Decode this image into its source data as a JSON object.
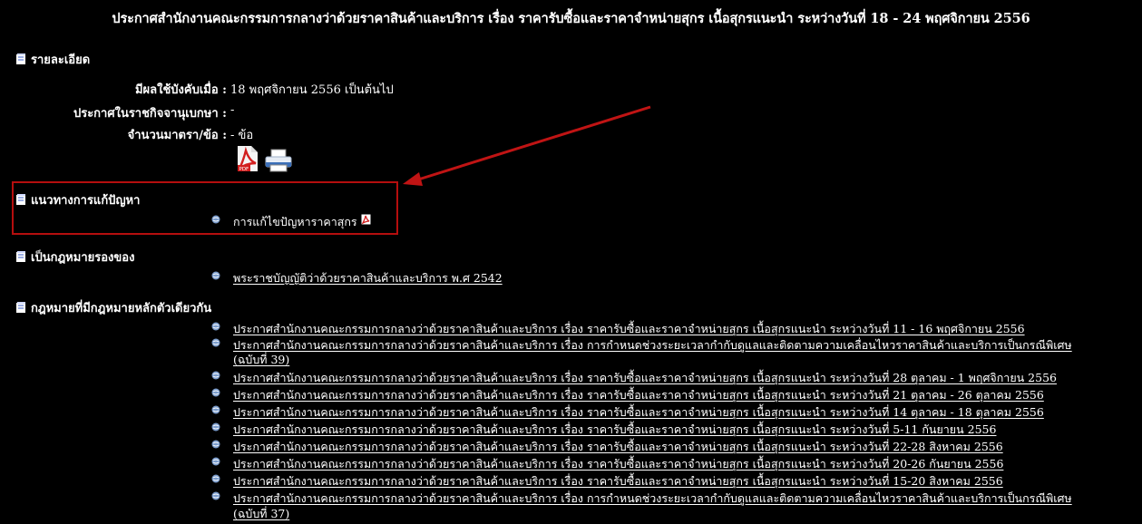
{
  "page_title": "ประกาศสำนักงานคณะกรรมการกลางว่าด้วยราคาสินค้าและบริการ เรื่อง ราคารับซื้อและราคาจำหน่ายสุกร เนื้อสุกรแนะนำ ระหว่างวันที่ 18 - 24 พฤศจิกายน 2556",
  "details": {
    "heading": "รายละเอียด",
    "effective_label": "มีผลใช้บังคับเมื่อ :",
    "effective_value": "18 พฤศจิกายน 2556 เป็นต้นไป",
    "gazette_label": "ประกาศในราชกิจจานุเบกษา :",
    "gazette_value": "-",
    "sections_label": "จำนวนมาตรา/ข้อ :",
    "sections_value": "- ข้อ"
  },
  "solution": {
    "heading": "แนวทางการแก้ปัญหา",
    "item": "การแก้ไขปัญหาราคาสุกร"
  },
  "subordinate": {
    "heading": "เป็นกฎหมายรองของ",
    "item": "พระราชบัญญัติว่าด้วยราคาสินค้าและบริการ พ.ศ 2542"
  },
  "related": {
    "heading": "กฎหมายที่มีกฎหมายหลักตัวเดียวกัน",
    "items": [
      "ประกาศสำนักงานคณะกรรมการกลางว่าด้วยราคาสินค้าและบริการ เรื่อง ราคารับซื้อและราคาจำหน่ายสุกร เนื้อสุกรแนะนำ ระหว่างวันที่ 11 - 16 พฤศจิกายน 2556",
      "ประกาศสำนักงานคณะกรรมการกลางว่าด้วยราคาสินค้าและบริการ เรื่อง การกำหนดช่วงระยะเวลากำกับดูแลและติดตามความเคลื่อนไหวราคาสินค้าและบริการเป็นกรณีพิเศษ",
      "(ฉบับที่ 39)",
      "ประกาศสำนักงานคณะกรรมการกลางว่าด้วยราคาสินค้าและบริการ เรื่อง ราคารับซื้อและราคาจำหน่ายสุกร เนื้อสุกรแนะนำ ระหว่างวันที่ 28 ตุลาคม - 1 พฤศจิกายน 2556",
      "ประกาศสำนักงานคณะกรรมการกลางว่าด้วยราคาสินค้าและบริการ เรื่อง ราคารับซื้อและราคาจำหน่ายสุกร เนื้อสุกรแนะนำ ระหว่างวันที่ 21 ตุลาคม - 26 ตุลาคม 2556",
      "ประกาศสำนักงานคณะกรรมการกลางว่าด้วยราคาสินค้าและบริการ เรื่อง ราคารับซื้อและราคาจำหน่ายสุกร เนื้อสุกรแนะนำ ระหว่างวันที่ 14 ตุลาคม - 18 ตุลาคม 2556",
      "ประกาศสำนักงานคณะกรรมการกลางว่าด้วยราคาสินค้าและบริการ เรื่อง ราคารับซื้อและราคาจำหน่ายสุกร เนื้อสุกรแนะนำ ระหว่างวันที่ 5-11 กันยายน 2556",
      "ประกาศสำนักงานคณะกรรมการกลางว่าด้วยราคาสินค้าและบริการ เรื่อง ราคารับซื้อและราคาจำหน่ายสุกร เนื้อสุกรแนะนำ ระหว่างวันที่ 22-28 สิงหาคม 2556",
      "ประกาศสำนักงานคณะกรรมการกลางว่าด้วยราคาสินค้าและบริการ เรื่อง ราคารับซื้อและราคาจำหน่ายสุกร เนื้อสุกรแนะนำ ระหว่างวันที่ 20-26 กันยายน 2556",
      "ประกาศสำนักงานคณะกรรมการกลางว่าด้วยราคาสินค้าและบริการ เรื่อง ราคารับซื้อและราคาจำหน่ายสุกร เนื้อสุกรแนะนำ ระหว่างวันที่ 15-20 สิงหาคม 2556",
      "ประกาศสำนักงานคณะกรรมการกลางว่าด้วยราคาสินค้าและบริการ เรื่อง การกำหนดช่วงระยะเวลากำกับดูแลและติดตามความเคลื่อนไหวราคาสินค้าและบริการเป็นกรณีพิเศษ",
      "(ฉบับที่ 37)"
    ]
  },
  "colors": {
    "background": "#000000",
    "text": "#ffffff",
    "annotation": "#b50e0e",
    "bullet": "#7a9ccc"
  }
}
